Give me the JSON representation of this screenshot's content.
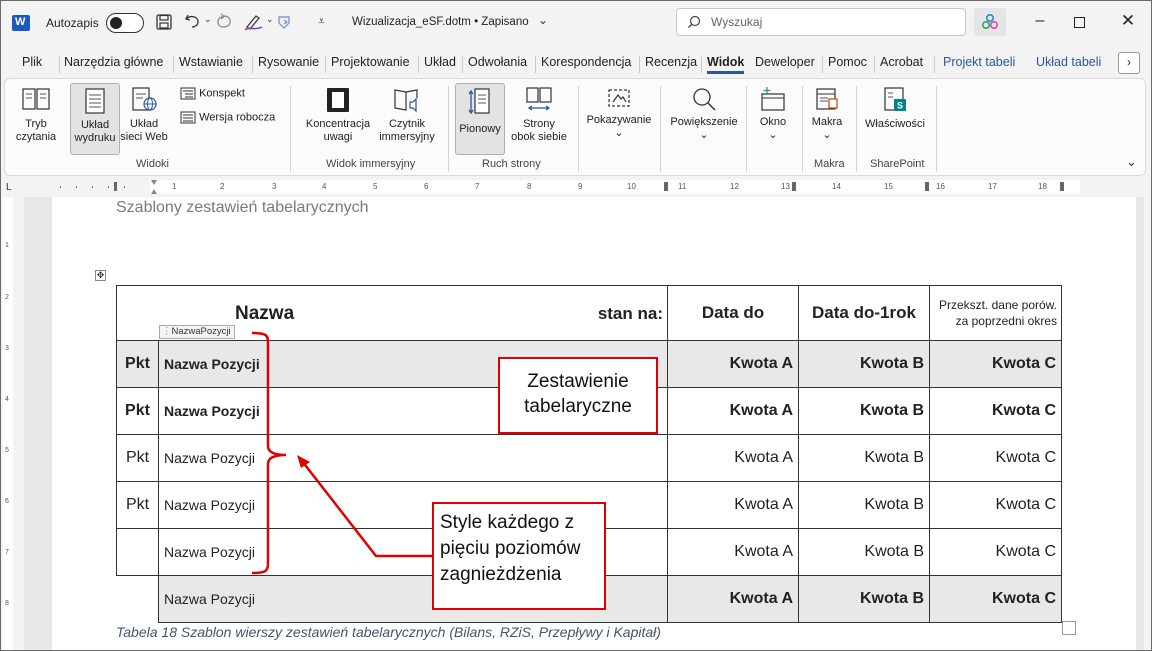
{
  "titlebar": {
    "autosave_label": "Autozapis",
    "autosave_state": "off",
    "doc_title": "Wizualizacja_eSF.dotm • Zapisano",
    "search_placeholder": "Wyszukaj"
  },
  "tabs": [
    "Plik",
    "Narzędzia główne",
    "Wstawianie",
    "Rysowanie",
    "Projektowanie",
    "Układ",
    "Odwołania",
    "Korespondencja",
    "Recenzja",
    "Widok",
    "Deweloper",
    "Pomoc",
    "Acrobat",
    "Projekt tabeli",
    "Układ tabeli"
  ],
  "active_tab": "Widok",
  "ribbon": {
    "widoki": {
      "label": "Widoki",
      "tryb1": "Tryb",
      "tryb2": "czytania",
      "uklad1": "Układ",
      "uklad2": "wydruku",
      "web1": "Układ",
      "web2": "sieci Web",
      "konspekt": "Konspekt",
      "wersja": "Wersja robocza"
    },
    "immersyjny": {
      "label": "Widok immersyjny",
      "konc1": "Koncentracja",
      "konc2": "uwagi",
      "czyt1": "Czytnik",
      "czyt2": "immersyjny"
    },
    "ruch": {
      "label": "Ruch strony",
      "pionowy": "Pionowy",
      "strony1": "Strony",
      "strony2": "obok siebie"
    },
    "pokazywanie": "Pokazywanie",
    "powiekszenie": "Powiększenie",
    "okno": "Okno",
    "makra": {
      "label": "Makra",
      "button": "Makra"
    },
    "sharepoint": {
      "label": "SharePoint",
      "button": "Właściwości"
    }
  },
  "document": {
    "heading": "Szablony zestawień tabelarycznych",
    "style_tag": "NazwaPozycji",
    "header_row": {
      "nazwa": "Nazwa",
      "stan": "stan na:",
      "data_do": "Data do",
      "data_do_1rok": "Data do-1rok",
      "przekszt1": "Przekszt. dane porów.",
      "przekszt2": "za poprzedni okres"
    },
    "rows": [
      {
        "pkt": "Pkt",
        "name": "Nazwa Pozycji",
        "a": "Kwota A",
        "b": "Kwota B",
        "c": "Kwota C"
      },
      {
        "pkt": "Pkt",
        "name": "Nazwa Pozycji",
        "a": "Kwota A",
        "b": "Kwota B",
        "c": "Kwota C"
      },
      {
        "pkt": "Pkt",
        "name": "Nazwa Pozycji",
        "a": "Kwota A",
        "b": "Kwota B",
        "c": "Kwota C"
      },
      {
        "pkt": "Pkt",
        "name": "Nazwa Pozycji",
        "a": "Kwota A",
        "b": "Kwota B",
        "c": "Kwota C"
      },
      {
        "pkt": "",
        "name": "Nazwa Pozycji",
        "a": "Kwota A",
        "b": "Kwota B",
        "c": "Kwota C"
      },
      {
        "pkt": "",
        "name": "Nazwa Pozycji",
        "a": "Kwota A",
        "b": "Kwota B",
        "c": "Kwota C"
      }
    ],
    "caption": "Tabela 18 Szablon wierszy zestawień tabelarycznych (Bilans, RZiS, Przepływy i Kapitał)"
  },
  "callouts": {
    "table_line1": "Zestawienie",
    "table_line2": "tabelaryczne",
    "styles_line1": "Style każdego z",
    "styles_line2": "pięciu poziomów",
    "styles_line3": "zagnieżdżenia"
  },
  "colors": {
    "accent": "#2b579a",
    "word_blue": "#185abd",
    "callout_red": "#e00000",
    "sharepoint_teal": "#038387"
  }
}
